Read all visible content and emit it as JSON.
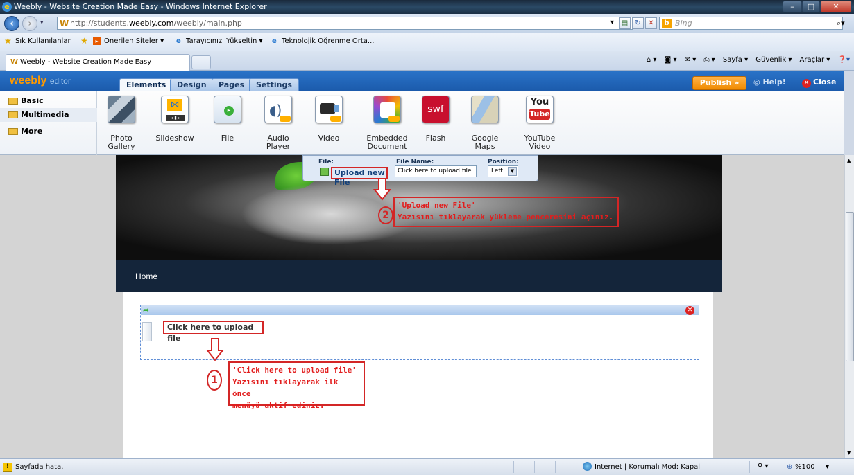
{
  "window": {
    "title": "Weebly - Website Creation Made Easy - Windows Internet Explorer"
  },
  "address": {
    "url_prefix": "http://students.",
    "url_host": "weebly.com",
    "url_suffix": "/weebly/main.php",
    "search_placeholder": "Bing"
  },
  "favorites": {
    "items": [
      "Sık Kullanılanlar",
      "Önerilen Siteler ▾",
      "Tarayıcınızı Yükseltin ▾",
      "Teknolojik Öğrenme Orta..."
    ]
  },
  "tabs": {
    "active_title": "Weebly - Website Creation Made Easy"
  },
  "command_bar": {
    "items": [
      "Sayfa ▾",
      "Güvenlik ▾",
      "Araçlar ▾"
    ]
  },
  "weebly": {
    "logo": "weebly",
    "logo_suffix": "editor",
    "tabs": [
      "Elements",
      "Design",
      "Pages",
      "Settings"
    ],
    "publish": "Publish »",
    "help": "Help!",
    "close": "Close"
  },
  "categories": [
    "Basic",
    "Multimedia",
    "More"
  ],
  "tools": [
    {
      "label": "Photo Gallery"
    },
    {
      "label": "Slideshow"
    },
    {
      "label": "File"
    },
    {
      "label": "Audio Player"
    },
    {
      "label": "Video"
    },
    {
      "label": "Embedded Document"
    },
    {
      "label": "Flash",
      "icon_text": "swf"
    },
    {
      "label": "Google Maps"
    },
    {
      "label": "YouTube Video",
      "icon_text": "You",
      "icon_text2": "Tube"
    }
  ],
  "popup": {
    "file_label": "File:",
    "upload_link": "Upload new File",
    "filename_label": "File Name:",
    "filename_value": "Click here to upload file",
    "position_label": "Position:",
    "position_value": "Left"
  },
  "site": {
    "nav_home": "Home",
    "file_placeholder": "Click here to upload file"
  },
  "annotations": {
    "step1_num": "1",
    "step1_line1": "'Click here to upload file'",
    "step1_line2": "Yazısını tıklayarak ilk önce",
    "step1_line3": "menüyü aktif ediniz.",
    "step2_num": "2",
    "step2_line1": "'Upload new File'",
    "step2_line2": "Yazısını tıklayarak yükleme penceresini açınız."
  },
  "status": {
    "left_text": "Sayfada hata.",
    "zone": "Internet | Korumalı Mod: Kapalı",
    "zoom": "%100"
  },
  "colors": {
    "annotation_red": "#d32626",
    "weebly_blue": "#1b5aab",
    "publish_orange": "#f08a00"
  }
}
